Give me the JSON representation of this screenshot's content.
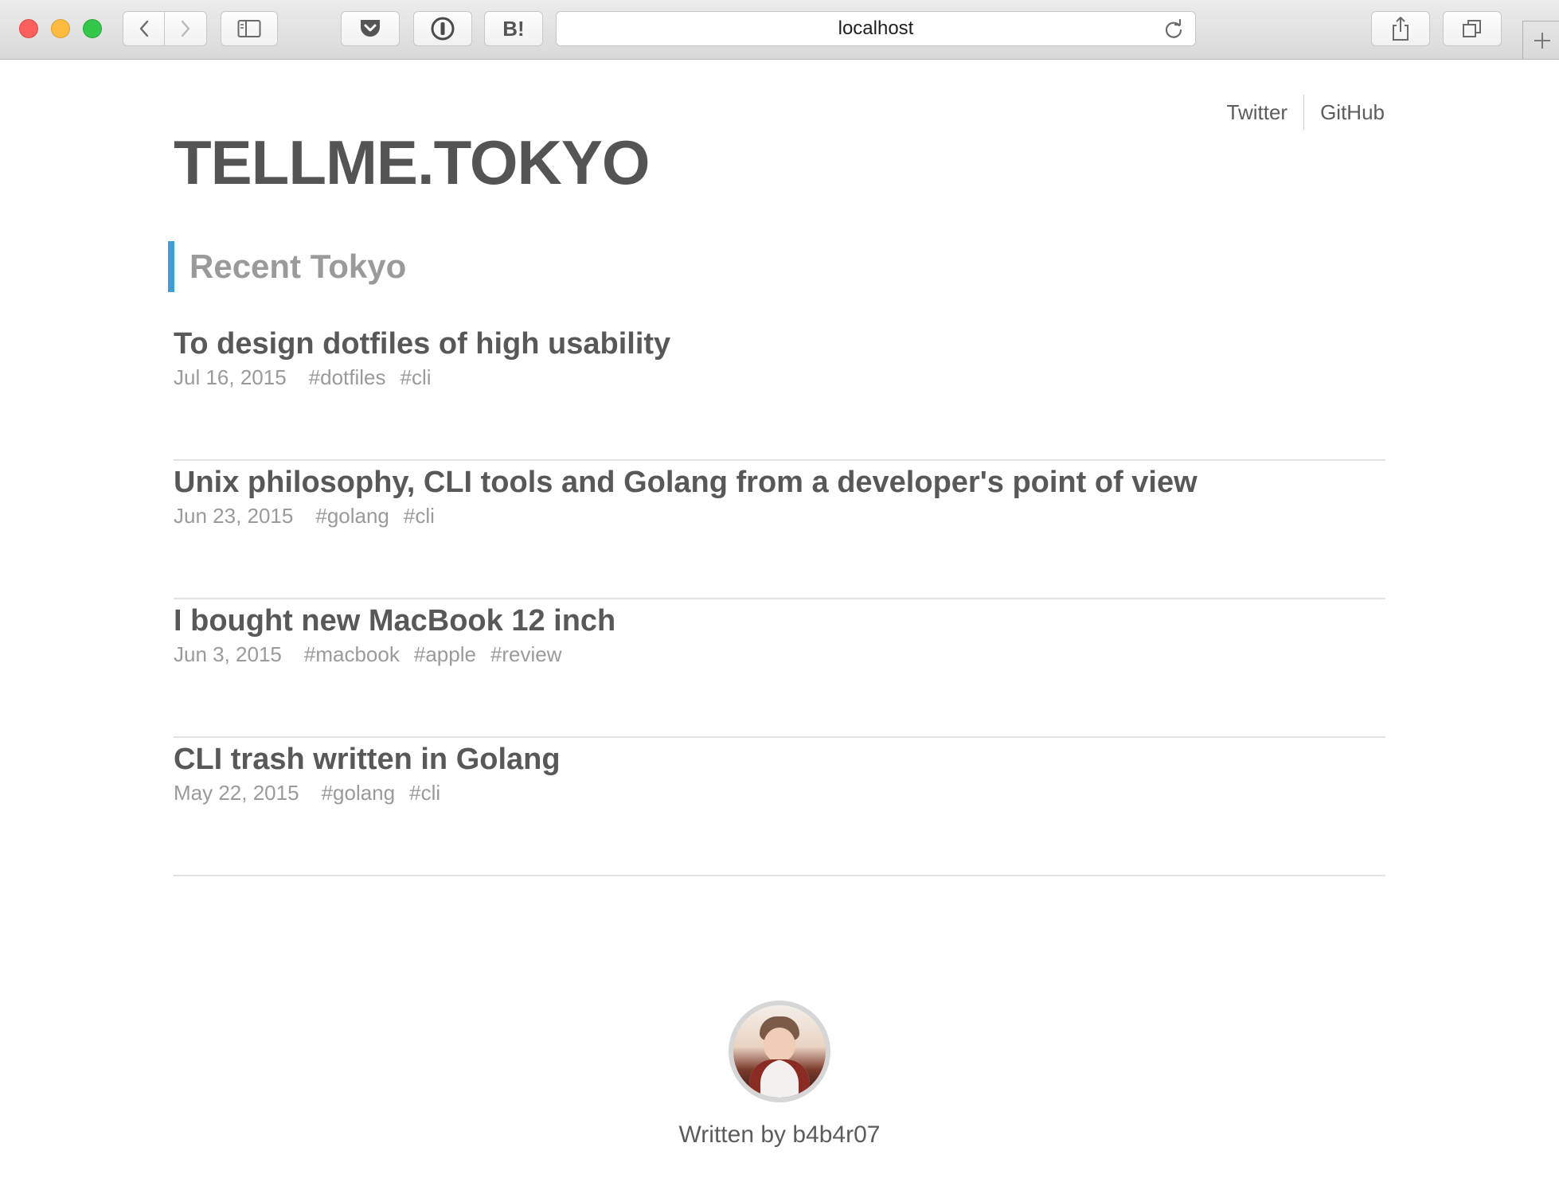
{
  "browser": {
    "address": "localhost",
    "pocket_icon": "pocket-icon",
    "onepassword_icon": "onepassword-icon",
    "hatena_label": "B!"
  },
  "header": {
    "links": [
      {
        "label": "Twitter"
      },
      {
        "label": "GitHub"
      }
    ],
    "site_title": "TELLME.TOKYO"
  },
  "section": {
    "title": "Recent Tokyo"
  },
  "posts": [
    {
      "title": "To design dotfiles of high usability",
      "date": "Jul 16, 2015",
      "tags": [
        "#dotfiles",
        "#cli"
      ]
    },
    {
      "title": "Unix philosophy, CLI tools and Golang from a developer's point of view",
      "date": "Jun 23, 2015",
      "tags": [
        "#golang",
        "#cli"
      ]
    },
    {
      "title": "I bought new MacBook 12 inch",
      "date": "Jun 3, 2015",
      "tags": [
        "#macbook",
        "#apple",
        "#review"
      ]
    },
    {
      "title": "CLI trash written in Golang",
      "date": "May 22, 2015",
      "tags": [
        "#golang",
        "#cli"
      ]
    }
  ],
  "footer": {
    "written_by": "Written by b4b4r07"
  },
  "colors": {
    "accent": "#3aa0d8",
    "text": "#585858",
    "muted": "#9a9a9a"
  }
}
